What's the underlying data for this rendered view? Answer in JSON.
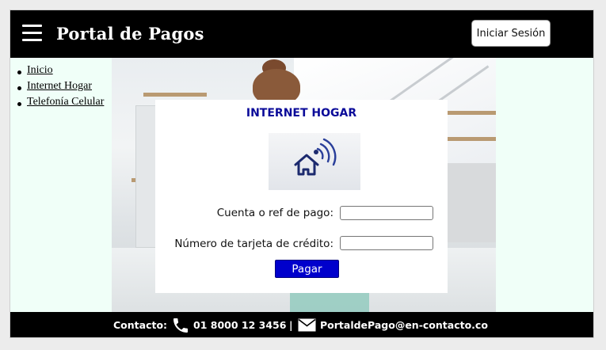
{
  "header": {
    "title": "Portal de Pagos",
    "login_label": "Iniciar Sesión"
  },
  "sidenav": {
    "items": [
      {
        "label": "Inicio"
      },
      {
        "label": "Internet Hogar"
      },
      {
        "label": "Telefonía Celular"
      }
    ]
  },
  "card": {
    "title": "INTERNET HOGAR",
    "image_icon": "home-wifi-icon",
    "fields": [
      {
        "label": "Cuenta o ref de pago:",
        "value": ""
      },
      {
        "label": "Número de tarjeta de crédito:",
        "value": ""
      }
    ],
    "submit_label": "Pagar"
  },
  "footer": {
    "contact_label": "Contacto:",
    "phone": "01 8000 12 3456",
    "separator": "|",
    "email": "PortaldePago@en-contacto.co"
  },
  "colors": {
    "header_bg": "#000000",
    "page_bg": "#f0fff8",
    "title_blue": "#0a0a99",
    "button_blue": "#0000cc"
  }
}
